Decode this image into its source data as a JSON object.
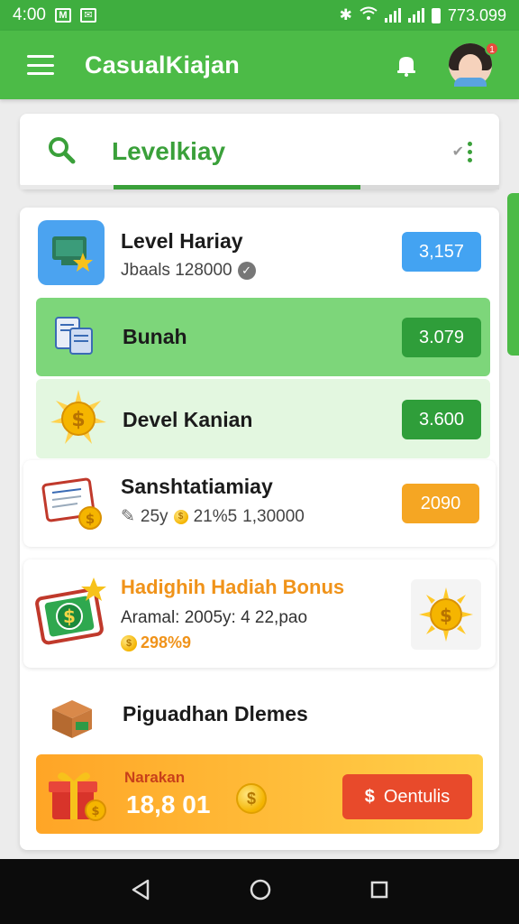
{
  "status_bar": {
    "time": "4:00",
    "right_text": "773.099"
  },
  "app_bar": {
    "title": "CasualKiajan",
    "notification_count": "1"
  },
  "search": {
    "text": "Levelkiay",
    "progress_percent": 71
  },
  "items": [
    {
      "title": "Level Hariay",
      "sub": "Jbaals 128000",
      "value": "3,157",
      "color": "#43a3f2"
    },
    {
      "title": "Bunah",
      "value": "3.079",
      "color": "#2f9e3a"
    },
    {
      "title": "Devel Kanian",
      "value": "3.600",
      "color": "#2f9e3a"
    },
    {
      "title": "Sanshtatiamiay",
      "sub_a": "25y",
      "sub_b": "21%5",
      "sub_c": "1,30000",
      "value": "2090",
      "color": "#f5a623"
    }
  ],
  "bonus": {
    "title": "Hadighih Hadiah Bonus",
    "line": "Aramal: 2005y: 4 22,pao",
    "coins": "298%9"
  },
  "promo": {
    "title": "Piguadhan Dlemes",
    "label": "Narakan",
    "amount": "18,8 01",
    "button": "Oentulis"
  }
}
